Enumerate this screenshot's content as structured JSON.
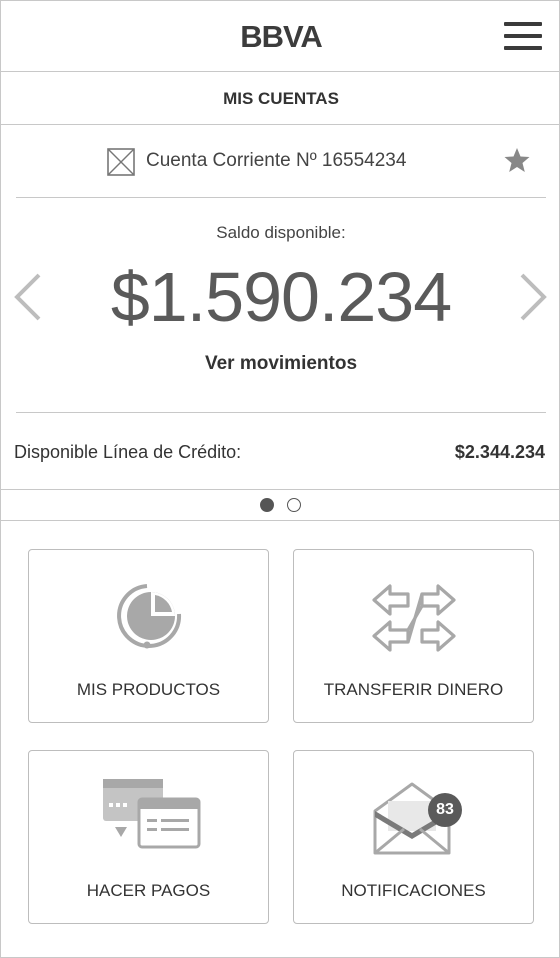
{
  "header": {
    "logo": "BBVA",
    "menu_icon": "hamburger-menu-icon"
  },
  "section": {
    "title": "MIS CUENTAS"
  },
  "account": {
    "icon": "account-image-placeholder-icon",
    "name": "Cuenta Corriente Nº 16554234",
    "favorite_icon": "star-icon",
    "balance_label": "Saldo disponible:",
    "balance": "$1.590.234",
    "movements_link": "Ver movimientos",
    "credit_label": "Disponible Línea de Crédito:",
    "credit_value": "$2.344.234"
  },
  "carousel": {
    "pages": 2,
    "active_page": 1,
    "prev_icon": "chevron-left-icon",
    "next_icon": "chevron-right-icon"
  },
  "tiles": [
    {
      "label": "MIS PRODUCTOS",
      "icon": "pie-chart-icon"
    },
    {
      "label": "TRANSFERIR DINERO",
      "icon": "transfer-arrows-icon"
    },
    {
      "label": "HACER PAGOS",
      "icon": "payment-cards-icon"
    },
    {
      "label": "NOTIFICACIONES",
      "icon": "envelope-icon",
      "badge": "83"
    }
  ],
  "colors": {
    "border": "#c8c8c8",
    "icon_gray": "#a8a8a8",
    "text_dark": "#333333",
    "badge_bg": "#5a5a5a"
  }
}
